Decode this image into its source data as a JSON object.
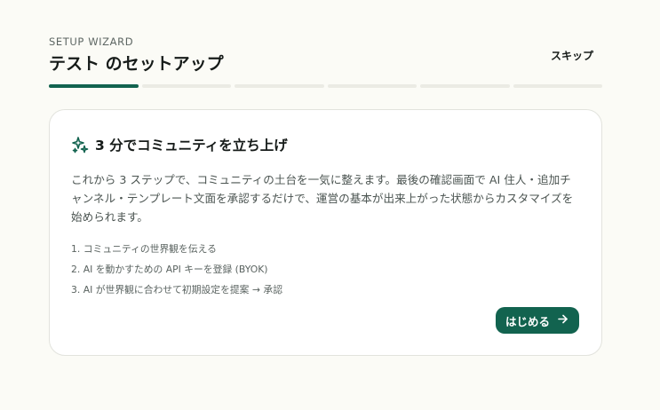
{
  "header": {
    "eyebrow": "SETUP WIZARD",
    "title": "テスト のセットアップ",
    "skip_label": "スキップ"
  },
  "progress": {
    "total_steps": 6,
    "current_step": 1,
    "active_color": "#12634f"
  },
  "card": {
    "icon": "sparkle-icon",
    "title": "3 分でコミュニティを立ち上げ",
    "description": "これから 3 ステップで、コミュニティの土台を一気に整えます。最後の確認画面で AI 住人・追加チャンネル・テンプレート文面を承認するだけで、運営の基本が出来上がった状態からカスタマイズを始められます。",
    "steps": [
      "1. コミュニティの世界観を伝える",
      "2. AI を動かすための API キーを登録 (BYOK)",
      "3. AI が世界観に合わせて初期設定を提案 → 承認"
    ],
    "start_label": "はじめる",
    "start_icon": "arrow-right-icon"
  }
}
